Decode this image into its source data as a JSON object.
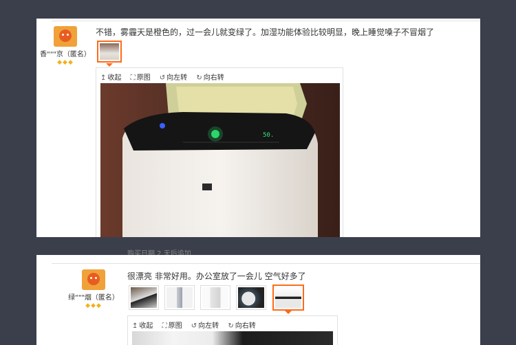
{
  "reviews": [
    {
      "user": "香\"\"\"京（匿名）",
      "comment": "不错，雾霾天是橙色的，过一会儿就变绿了。加湿功能体验比较明显，晚上睡觉嗓子不冒烟了",
      "toolbar": {
        "collapse": "收起",
        "original": "原图",
        "rotate_left": "向左转",
        "rotate_right": "向右转"
      },
      "display_reading": "50."
    },
    {
      "user": "绿\"\"\"烟（匿名）",
      "comment": "很漂亮 非常好用。办公室放了一会儿 空气好多了",
      "toolbar": {
        "collapse": "收起",
        "original": "原图",
        "rotate_left": "向左转",
        "rotate_right": "向右转"
      }
    }
  ],
  "between_text": "购买日期 2 天后追加",
  "icons": {
    "collapse": "up-arrow-icon",
    "original": "fullscreen-icon",
    "rotate_left": "rotate-left-icon",
    "rotate_right": "rotate-right-icon"
  },
  "colors": {
    "background": "#3b3f4b",
    "active_thumb_border": "#ff6a1a",
    "diamond": "#f2b21c"
  }
}
